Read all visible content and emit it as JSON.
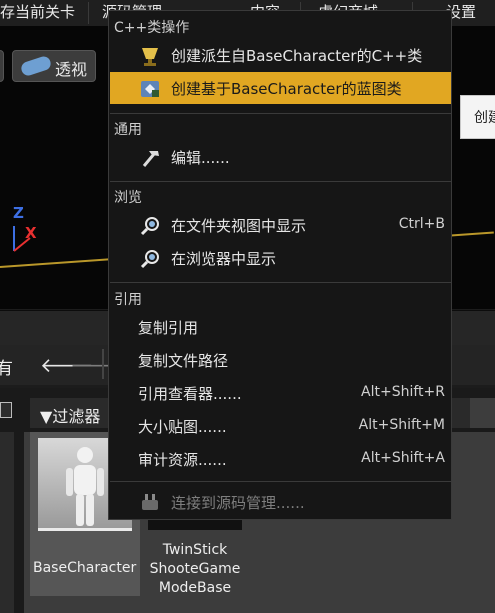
{
  "toolbar": {
    "items": [
      "存当前关卡",
      "源码管理",
      "内容",
      "虚幻商城",
      "设置"
    ]
  },
  "viewport": {
    "perspective_label": "透视",
    "axis_z": "Z",
    "axis_x": "X"
  },
  "tooltip": {
    "text": "创建"
  },
  "content_browser": {
    "nav_label": "有",
    "filter_label": "过滤器",
    "assets": [
      {
        "name": "BaseCharacter"
      },
      {
        "name": "TwinStick ShooteGame ModeBase"
      }
    ]
  },
  "context_menu": {
    "sections": {
      "cpp": "C++类操作",
      "general": "通用",
      "explore": "浏览",
      "references": "引用"
    },
    "items": {
      "create_cpp": "创建派生自BaseCharacter的C++类",
      "create_blueprint": "创建基于BaseCharacter的蓝图类",
      "edit": "编辑......",
      "show_in_folder": "在文件夹视图中显示",
      "show_in_folder_shortcut": "Ctrl+B",
      "show_in_browser": "在浏览器中显示",
      "copy_reference": "复制引用",
      "copy_file_path": "复制文件路径",
      "reference_viewer": "引用查看器......",
      "reference_viewer_shortcut": "Alt+Shift+R",
      "size_map": "大小贴图......",
      "size_map_shortcut": "Alt+Shift+M",
      "audit_assets": "审计资源......",
      "audit_assets_shortcut": "Alt+Shift+A",
      "connect_source_control": "连接到源码管理......"
    },
    "highlight_color": "#e1a722"
  }
}
